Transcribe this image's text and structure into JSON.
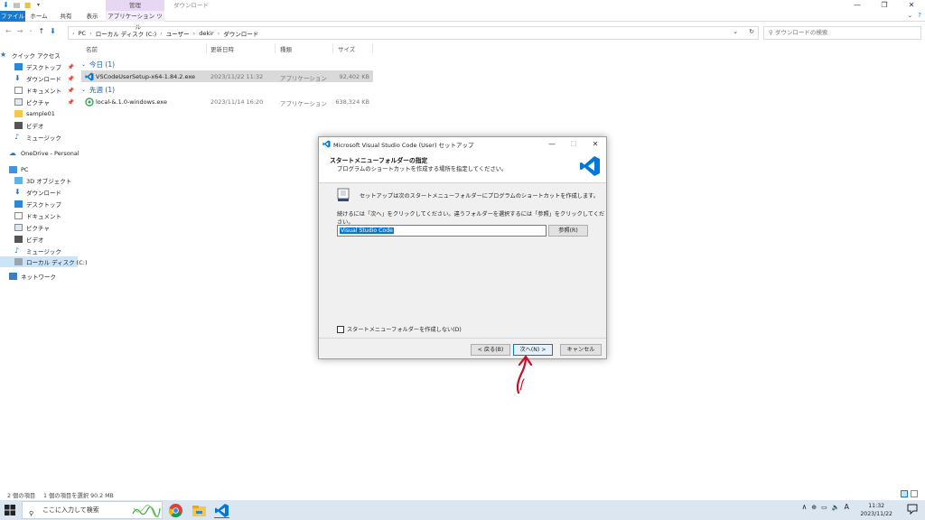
{
  "explorer": {
    "ribbon_tabs": {
      "file": "ファイル",
      "home": "ホーム",
      "share": "共有",
      "view": "表示",
      "manage": "管理",
      "app_tools": "アプリケーション ツール"
    },
    "window_title": "ダウンロード",
    "address": {
      "crumbs": [
        "PC",
        "ローカル ディスク (C:)",
        "ユーザー",
        "dekir",
        "ダウンロード"
      ],
      "search_placeholder": "ダウンロードの検索"
    },
    "sidebar": {
      "items": [
        {
          "label": "クイック アクセス",
          "icon": "star-icon"
        },
        {
          "label": "デスクトップ",
          "icon": "desktop-icon",
          "pinned": true
        },
        {
          "label": "ダウンロード",
          "icon": "download-icon",
          "pinned": true
        },
        {
          "label": "ドキュメント",
          "icon": "document-icon",
          "pinned": true
        },
        {
          "label": "ピクチャ",
          "icon": "picture-icon",
          "pinned": true
        },
        {
          "label": "sample01",
          "icon": "folder-icon"
        },
        {
          "label": "ビデオ",
          "icon": "video-icon"
        },
        {
          "label": "ミュージック",
          "icon": "music-icon"
        },
        {
          "label": "OneDrive - Personal",
          "icon": "cloud-icon"
        },
        {
          "label": "PC",
          "icon": "pc-icon"
        },
        {
          "label": "3D オブジェクト",
          "icon": "cube-icon"
        },
        {
          "label": "ダウンロード",
          "icon": "download-icon"
        },
        {
          "label": "デスクトップ",
          "icon": "desktop-icon"
        },
        {
          "label": "ドキュメント",
          "icon": "document-icon"
        },
        {
          "label": "ピクチャ",
          "icon": "picture-icon"
        },
        {
          "label": "ビデオ",
          "icon": "video-icon"
        },
        {
          "label": "ミュージック",
          "icon": "music-icon"
        },
        {
          "label": "ローカル ディスク (C:)",
          "icon": "drive-icon"
        },
        {
          "label": "ネットワーク",
          "icon": "network-icon"
        }
      ]
    },
    "columns": {
      "name": "名前",
      "date": "更新日時",
      "type": "種類",
      "size": "サイズ"
    },
    "groups": [
      {
        "title": "今日 (1)",
        "files": [
          {
            "name": "VSCodeUserSetup-x64-1.84.2.exe",
            "date": "2023/11/22 11:32",
            "type": "アプリケーション",
            "size": "92,402 KB"
          }
        ]
      },
      {
        "title": "先週 (1)",
        "files": [
          {
            "name": "local-&.1.0-windows.exe",
            "date": "2023/11/14 16:20",
            "type": "アプリケーション",
            "size": "638,324 KB"
          }
        ]
      }
    ],
    "status": {
      "count": "2 個の項目",
      "selected": "1 個の項目を選択  90.2 MB"
    }
  },
  "dialog": {
    "title": "Microsoft Visual Studio Code (User) セットアップ",
    "heading": "スタートメニューフォルダーの指定",
    "subheading": "プログラムのショートカットを作成する場所を指定してください。",
    "line1": "セットアップは次のスタートメニューフォルダーにプログラムのショートカットを作成します。",
    "line2": "続けるには「次へ」をクリックしてください。違うフォルダーを選択するには「参照」をクリックしてください。",
    "folder_value": "Visual Studio Code",
    "browse_label": "参照(R)",
    "no_folder_label": "スタートメニューフォルダーを作成しない(D)",
    "back_label": "< 戻る(B)",
    "next_label": "次へ(N) >",
    "cancel_label": "キャンセル"
  },
  "taskbar": {
    "search_placeholder": "ここに入力して検索",
    "time": "11:32",
    "date": "2023/11/22",
    "ime": "A"
  },
  "colors": {
    "accent": "#1979ca",
    "vscode_blue": "#0078d7",
    "annotation_red": "#c0102a"
  }
}
